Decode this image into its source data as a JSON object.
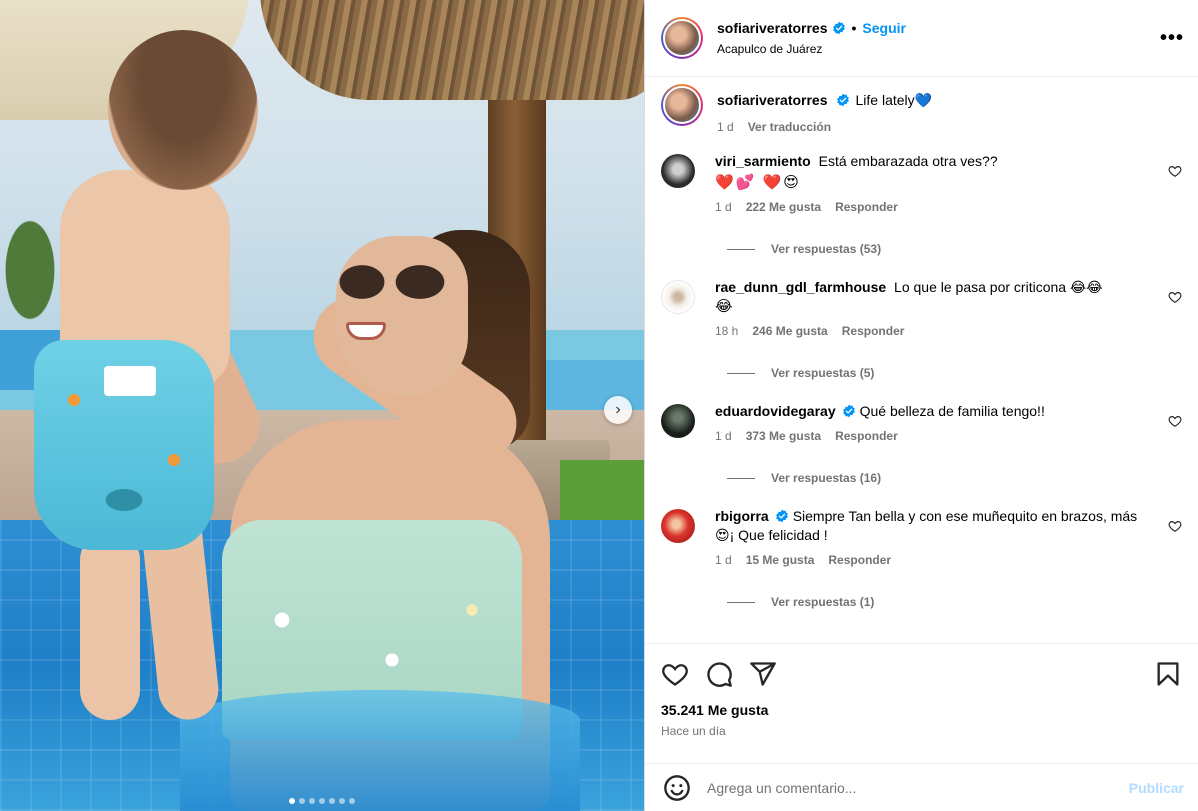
{
  "post": {
    "author": "sofiariveratorres",
    "location": "Acapulco de Juárez",
    "follow_label": "Seguir",
    "separator": "•",
    "more_label": "•••",
    "media": {
      "slide_count": 7,
      "active_slide": 1,
      "next_label": "›"
    }
  },
  "caption": {
    "author": "sofiariveratorres",
    "text": "Life lately💙",
    "time": "1 d",
    "translate_label": "Ver traducción"
  },
  "comments": [
    {
      "author": "viri_sarmiento",
      "verified": false,
      "text": "Está embarazada otra ves??",
      "extra": "❤️💕 ❤️😍",
      "time": "1 d",
      "likes": "222 Me gusta",
      "reply_label": "Responder",
      "replies_label": "Ver respuestas (53)"
    },
    {
      "author": "rae_dunn_gdl_farmhouse",
      "verified": false,
      "text": "Lo que le pasa por criticona 😂😂",
      "extra": "😂",
      "time": "18 h",
      "likes": "246 Me gusta",
      "reply_label": "Responder",
      "replies_label": "Ver respuestas (5)"
    },
    {
      "author": "eduardovidegaray",
      "verified": true,
      "text": "Qué belleza de familia tengo!!",
      "time": "1 d",
      "likes": "373 Me gusta",
      "reply_label": "Responder",
      "replies_label": "Ver respuestas (16)"
    },
    {
      "author": "rbigorra",
      "verified": true,
      "text": "Siempre Tan bella y con ese muñequito en brazos, más 😍¡ Que felicidad !",
      "time": "1 d",
      "likes": "15 Me gusta",
      "reply_label": "Responder",
      "replies_label": "Ver respuestas (1)"
    }
  ],
  "actions": {
    "like_count": "35.241 Me gusta",
    "posted_ago": "Hace un día"
  },
  "add_comment": {
    "placeholder": "Agrega un comentario...",
    "publish_label": "Publicar"
  },
  "colors": {
    "link_blue": "#0095f6",
    "muted_text": "#737373",
    "publish_disabled": "#b3dbff",
    "divider": "#efefef"
  },
  "icons": {
    "verified": "verified-badge-icon",
    "like": "heart-icon",
    "comment": "comment-bubble-icon",
    "share": "paper-plane-icon",
    "save": "bookmark-icon",
    "emoji": "smiley-icon",
    "more": "ellipsis-icon",
    "next": "chevron-right-icon"
  }
}
